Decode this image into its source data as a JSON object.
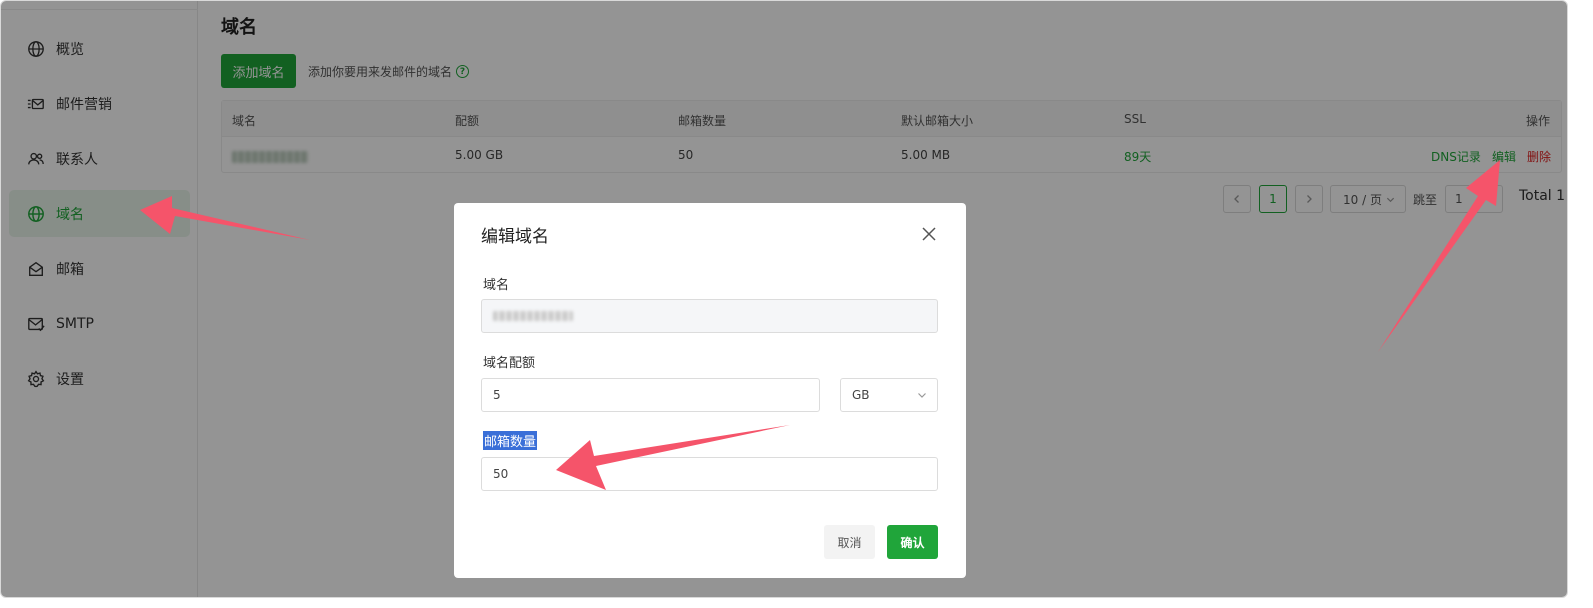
{
  "sidebar": {
    "items": [
      {
        "label": "概览",
        "icon": "globe-icon"
      },
      {
        "label": "邮件营销",
        "icon": "mail-list-icon"
      },
      {
        "label": "联系人",
        "icon": "contacts-icon"
      },
      {
        "label": "域名",
        "icon": "globe-icon",
        "active": true
      },
      {
        "label": "邮箱",
        "icon": "mailbox-icon"
      },
      {
        "label": "SMTP",
        "icon": "smtp-icon"
      },
      {
        "label": "设置",
        "icon": "gear-icon"
      }
    ]
  },
  "main": {
    "title": "域名",
    "add_button": "添加域名",
    "hint": "添加你要用来发邮件的域名",
    "hint_icon": "?",
    "table": {
      "headers": [
        "域名",
        "配额",
        "邮箱数量",
        "默认邮箱大小",
        "SSL",
        "操作"
      ],
      "row": {
        "quota": "5.00 GB",
        "mailbox_count": "50",
        "default_size": "5.00 MB",
        "ssl": "89天",
        "actions": {
          "dns": "DNS记录",
          "edit": "编辑",
          "delete": "删除"
        }
      }
    },
    "pager": {
      "current_page": "1",
      "page_size": "10 / 页",
      "jump_label": "跳至",
      "jump_value": "1",
      "total": "Total 1"
    }
  },
  "modal": {
    "title": "编辑域名",
    "domain_label": "域名",
    "quota_label": "域名配额",
    "quota_value": "5",
    "quota_unit": "GB",
    "mailbox_label": "邮箱数量",
    "mailbox_value": "50",
    "cancel": "取消",
    "confirm": "确认"
  },
  "colors": {
    "accent": "#20a53a",
    "danger": "#e02020",
    "arrow": "#f5546a"
  }
}
